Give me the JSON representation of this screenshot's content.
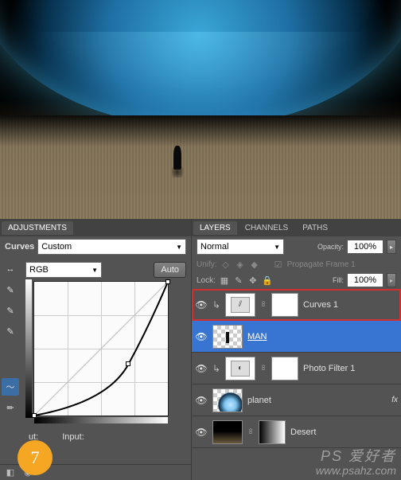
{
  "adjustments": {
    "tab_label": "ADJUSTMENTS",
    "title": "Curves",
    "preset": "Custom",
    "channel": "RGB",
    "auto_label": "Auto",
    "output_label": "ut:",
    "input_label": "Input:"
  },
  "layers_panel": {
    "tabs": {
      "layers": "LAYERS",
      "channels": "CHANNELS",
      "paths": "PATHS"
    },
    "blend_mode": "Normal",
    "opacity_label": "Opacity:",
    "opacity_value": "100%",
    "unify_label": "Unify:",
    "propagate_label": "Propagate Frame 1",
    "lock_label": "Lock:",
    "fill_label": "Fill:",
    "fill_value": "100%",
    "layers": [
      {
        "name": "Curves 1"
      },
      {
        "name": "MAN"
      },
      {
        "name": "Photo Filter 1"
      },
      {
        "name": "planet"
      },
      {
        "name": "Desert"
      }
    ],
    "fx_label": "fx"
  },
  "step_number": "7",
  "watermark": {
    "line1": "PS 爱好者",
    "line2": "www.psahz.com"
  },
  "chart_data": {
    "type": "line",
    "title": "Curves",
    "xlabel": "Input",
    "ylabel": "Output",
    "xlim": [
      0,
      255
    ],
    "ylim": [
      0,
      255
    ],
    "series": [
      {
        "name": "baseline",
        "x": [
          0,
          255
        ],
        "y": [
          0,
          255
        ]
      },
      {
        "name": "curve",
        "x": [
          0,
          180,
          255
        ],
        "y": [
          0,
          98,
          255
        ]
      }
    ]
  }
}
